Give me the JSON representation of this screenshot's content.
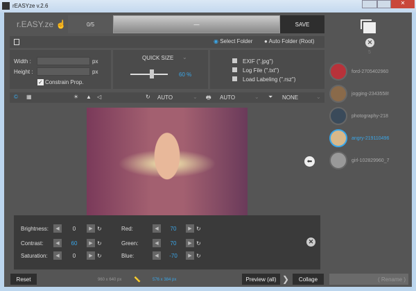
{
  "window": {
    "title": "rEASYze v.2.6"
  },
  "header": {
    "logo": "r.EASY.ze",
    "counter": "0/5",
    "progress_label": "—",
    "progress": 0,
    "save_label": "SAVE"
  },
  "folder": {
    "select_folder": "Select Folder",
    "auto_folder": "Auto Folder (Root)",
    "selected": "Select Folder"
  },
  "size": {
    "width_label": "Width :",
    "height_label": "Height :",
    "unit": "px",
    "width_value": "",
    "height_value": "",
    "constrain_label": "Constrain Prop.",
    "constrain_checked": true
  },
  "quick_size": {
    "label": "QUICK SIZE",
    "value": "60 %",
    "percent": 60
  },
  "options": [
    {
      "label": "EXIF (\".jpg\")",
      "checked": false
    },
    {
      "label": "Log File (\".txt\")",
      "checked": false
    },
    {
      "label": "Load Labeling (\".rsz\")",
      "checked": false
    }
  ],
  "toolbar": {
    "rotate": "AUTO",
    "print": "AUTO",
    "filter": "NONE"
  },
  "adjust": {
    "brightness": {
      "label": "Brightness:",
      "value": "0"
    },
    "contrast": {
      "label": "Contrast:",
      "value": "60"
    },
    "saturation": {
      "label": "Saturation:",
      "value": "0"
    },
    "red": {
      "label": "Red:",
      "value": "70"
    },
    "green": {
      "label": "Green:",
      "value": "70"
    },
    "blue": {
      "label": "Blue:",
      "value": "-70"
    }
  },
  "footer": {
    "reset": "Reset",
    "original_size": "960 x 640 px",
    "new_size": "576 x 384 px",
    "preview": "Preview (all)",
    "collage": "Collage",
    "rename": "( Rename )"
  },
  "sidebar": {
    "count": "5",
    "files": [
      {
        "name": "ford-2705402960",
        "active": false,
        "color": "#b8323a"
      },
      {
        "name": "jogging-2343558!",
        "active": false,
        "color": "#8a6a4a"
      },
      {
        "name": "photography-218",
        "active": false,
        "color": "#3a4a5a"
      },
      {
        "name": "angry-219110496",
        "active": true,
        "color": "#d8b88a"
      },
      {
        "name": "girl-102829960_7",
        "active": false,
        "color": "#999"
      }
    ]
  },
  "colors": {
    "accent": "#3aa6e8"
  }
}
